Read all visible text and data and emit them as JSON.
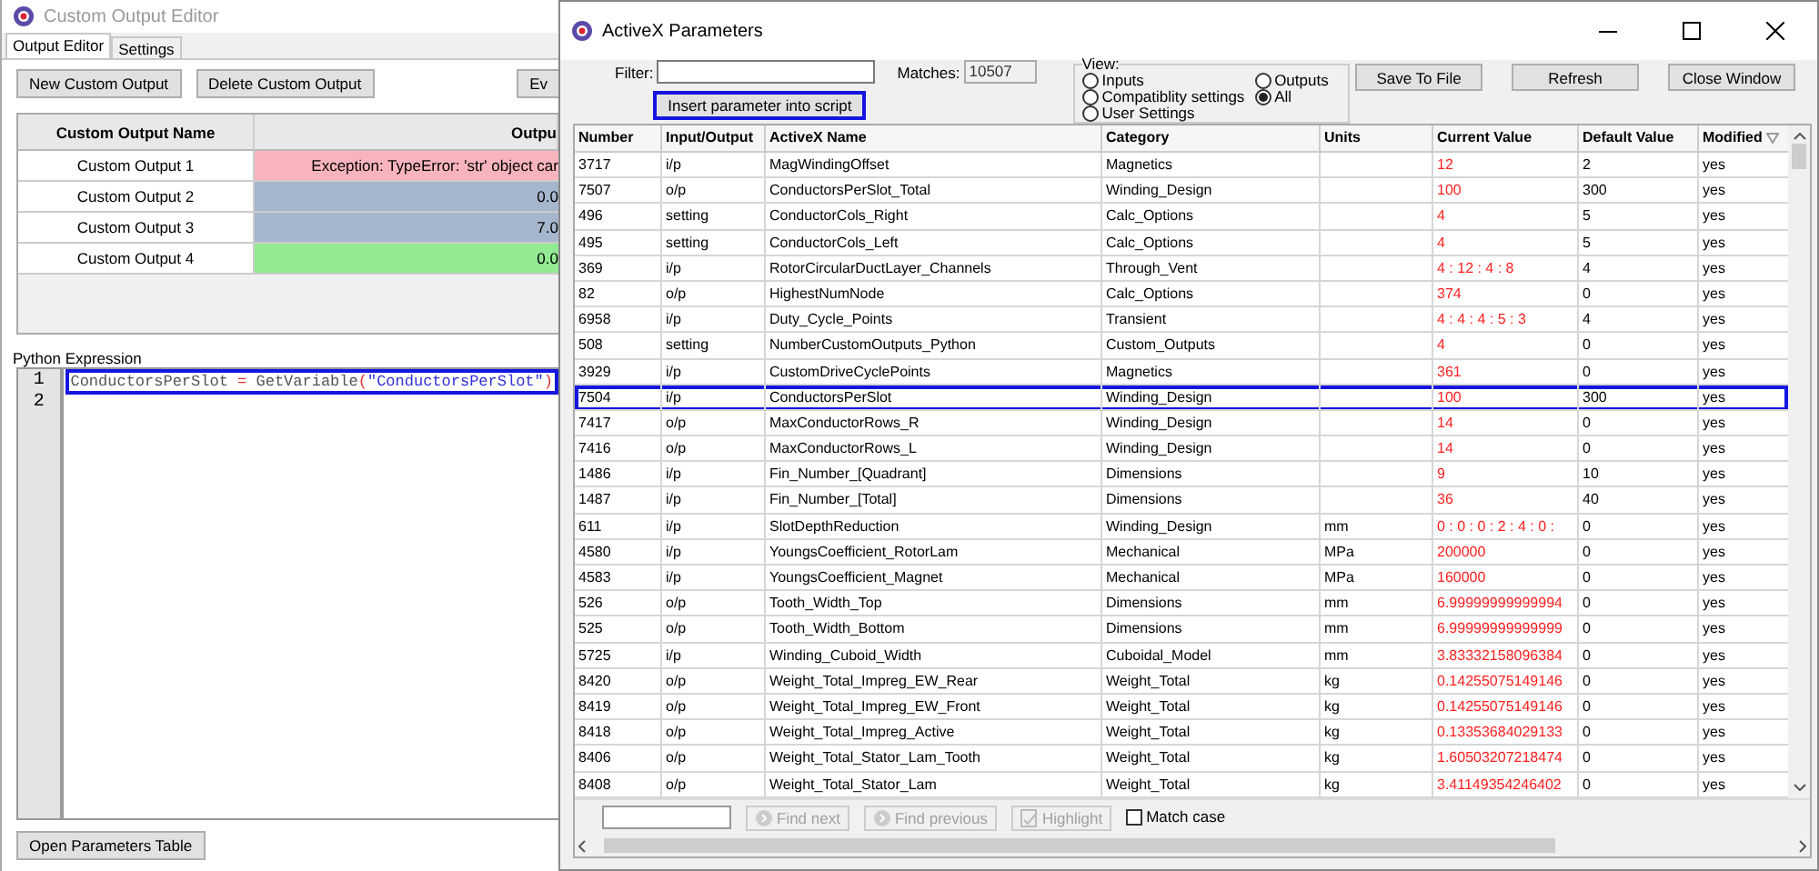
{
  "editor_window": {
    "title": "Custom Output Editor",
    "tabs": [
      {
        "label": "Output Editor",
        "selected": true
      },
      {
        "label": "Settings",
        "selected": false
      }
    ],
    "buttons": [
      "New Custom Output",
      "Delete Custom Output",
      "Ev"
    ],
    "grid": {
      "columns": [
        "Custom Output Name",
        "Outpu"
      ],
      "rows": [
        {
          "name": "Custom Output 1",
          "output": "Exception: TypeError: 'str' object car",
          "color": "#f8b4bc"
        },
        {
          "name": "Custom Output 2",
          "output": "0.0",
          "color": "#a6b6cc"
        },
        {
          "name": "Custom Output 3",
          "output": "7.0",
          "color": "#a6b6cc"
        },
        {
          "name": "Custom Output 4",
          "output": "0.0",
          "color": "#92ea92"
        }
      ]
    },
    "python_expression": {
      "label": "Python Expression",
      "lines": [
        {
          "number": "1",
          "highlighted": true,
          "tokens": [
            {
              "text": "ConductorsPerSlot ",
              "kind": "ident"
            },
            {
              "text": "= ",
              "kind": "op"
            },
            {
              "text": "GetVariable",
              "kind": "ident"
            },
            {
              "text": "(",
              "kind": "op"
            },
            {
              "text": "\"ConductorsPerSlot\"",
              "kind": "string"
            },
            {
              "text": ")",
              "kind": "op"
            }
          ]
        },
        {
          "number": "2",
          "highlighted": false
        }
      ]
    },
    "bottom_button": "Open Parameters Table"
  },
  "params_window": {
    "title": "ActiveX Parameters",
    "filter": {
      "label": "Filter:"
    },
    "insert_button": {
      "label": "Insert parameter into script",
      "highlighted": true
    },
    "matches": {
      "label": "Matches:",
      "value": "10507"
    },
    "view": {
      "label": "View:",
      "options": [
        {
          "label": "Inputs",
          "selected": false
        },
        {
          "label": "Outputs",
          "selected": false
        },
        {
          "label": "Compatiblity settings",
          "selected": false
        },
        {
          "label": "All",
          "selected": true
        },
        {
          "label": "User Settings",
          "selected": false
        }
      ]
    },
    "buttons": [
      "Save To File",
      "Refresh",
      "Close Window"
    ],
    "table": {
      "columns": [
        "Number",
        "Input/Output",
        "ActiveX Name",
        "Category",
        "Units",
        "Current Value",
        "Default Value",
        "Modified"
      ],
      "rows": [
        {
          "cells": [
            "3717",
            "i/p",
            "MagWindingOffset",
            "Magnetics",
            "",
            "12",
            "2",
            "yes"
          ],
          "highlighted": false
        },
        {
          "cells": [
            "7507",
            "o/p",
            "ConductorsPerSlot_Total",
            "Winding_Design",
            "",
            "100",
            "300",
            "yes"
          ],
          "highlighted": false
        },
        {
          "cells": [
            "496",
            "setting",
            "ConductorCols_Right",
            "Calc_Options",
            "",
            "4",
            "5",
            "yes"
          ],
          "highlighted": false
        },
        {
          "cells": [
            "495",
            "setting",
            "ConductorCols_Left",
            "Calc_Options",
            "",
            "4",
            "5",
            "yes"
          ],
          "highlighted": false
        },
        {
          "cells": [
            "369",
            "i/p",
            "RotorCircularDuctLayer_Channels",
            "Through_Vent",
            "",
            "4 : 12 : 4 : 8",
            "4",
            "yes"
          ],
          "highlighted": false
        },
        {
          "cells": [
            "82",
            "o/p",
            "HighestNumNode",
            "Calc_Options",
            "",
            "374",
            "0",
            "yes"
          ],
          "highlighted": false
        },
        {
          "cells": [
            "6958",
            "i/p",
            "Duty_Cycle_Points",
            "Transient",
            "",
            "4 : 4 : 4 : 5 : 3",
            "4",
            "yes"
          ],
          "highlighted": false
        },
        {
          "cells": [
            "508",
            "setting",
            "NumberCustomOutputs_Python",
            "Custom_Outputs",
            "",
            "4",
            "0",
            "yes"
          ],
          "highlighted": false
        },
        {
          "cells": [
            "3929",
            "i/p",
            "CustomDriveCyclePoints",
            "Magnetics",
            "",
            "361",
            "0",
            "yes"
          ],
          "highlighted": false
        },
        {
          "cells": [
            "7504",
            "i/p",
            "ConductorsPerSlot",
            "Winding_Design",
            "",
            "100",
            "300",
            "yes"
          ],
          "highlighted": true
        },
        {
          "cells": [
            "7417",
            "o/p",
            "MaxConductorRows_R",
            "Winding_Design",
            "",
            "14",
            "0",
            "yes"
          ],
          "highlighted": false
        },
        {
          "cells": [
            "7416",
            "o/p",
            "MaxConductorRows_L",
            "Winding_Design",
            "",
            "14",
            "0",
            "yes"
          ],
          "highlighted": false
        },
        {
          "cells": [
            "1486",
            "i/p",
            "Fin_Number_[Quadrant]",
            "Dimensions",
            "",
            "9",
            "10",
            "yes"
          ],
          "highlighted": false
        },
        {
          "cells": [
            "1487",
            "i/p",
            "Fin_Number_[Total]",
            "Dimensions",
            "",
            "36",
            "40",
            "yes"
          ],
          "highlighted": false
        },
        {
          "cells": [
            "611",
            "i/p",
            "SlotDepthReduction",
            "Winding_Design",
            "mm",
            "0 : 0 : 0 : 2 : 4 : 0 :",
            "0",
            "yes"
          ],
          "highlighted": false
        },
        {
          "cells": [
            "4580",
            "i/p",
            "YoungsCoefficient_RotorLam",
            "Mechanical",
            "MPa",
            "200000",
            "0",
            "yes"
          ],
          "highlighted": false
        },
        {
          "cells": [
            "4583",
            "i/p",
            "YoungsCoefficient_Magnet",
            "Mechanical",
            "MPa",
            "160000",
            "0",
            "yes"
          ],
          "highlighted": false
        },
        {
          "cells": [
            "526",
            "o/p",
            "Tooth_Width_Top",
            "Dimensions",
            "mm",
            "6.99999999999994",
            "0",
            "yes"
          ],
          "highlighted": false
        },
        {
          "cells": [
            "525",
            "o/p",
            "Tooth_Width_Bottom",
            "Dimensions",
            "mm",
            "6.99999999999999",
            "0",
            "yes"
          ],
          "highlighted": false
        },
        {
          "cells": [
            "5725",
            "i/p",
            "Winding_Cuboid_Width",
            "Cuboidal_Model",
            "mm",
            "3.83332158096384",
            "0",
            "yes"
          ],
          "highlighted": false
        },
        {
          "cells": [
            "8420",
            "o/p",
            "Weight_Total_Impreg_EW_Rear",
            "Weight_Total",
            "kg",
            "0.14255075149146",
            "0",
            "yes"
          ],
          "highlighted": false
        },
        {
          "cells": [
            "8419",
            "o/p",
            "Weight_Total_Impreg_EW_Front",
            "Weight_Total",
            "kg",
            "0.14255075149146",
            "0",
            "yes"
          ],
          "highlighted": false
        },
        {
          "cells": [
            "8418",
            "o/p",
            "Weight_Total_Impreg_Active",
            "Weight_Total",
            "kg",
            "0.13353684029133",
            "0",
            "yes"
          ],
          "highlighted": false
        },
        {
          "cells": [
            "8406",
            "o/p",
            "Weight_Total_Stator_Lam_Tooth",
            "Weight_Total",
            "kg",
            "1.60503207218474",
            "0",
            "yes"
          ],
          "highlighted": false
        },
        {
          "cells": [
            "8408",
            "o/p",
            "Weight_Total_Stator_Lam",
            "Weight_Total",
            "kg",
            "3.41149354246402",
            "0",
            "yes"
          ],
          "highlighted": false
        }
      ]
    },
    "find_bar": {
      "buttons": [
        {
          "label": "Find next",
          "disabled": true,
          "kind": "find"
        },
        {
          "label": "Find previous",
          "disabled": true,
          "kind": "find"
        },
        {
          "label": "Highlight",
          "disabled": true,
          "kind": "highlight"
        }
      ],
      "match_case": {
        "label": "Match case",
        "checked": false
      }
    }
  }
}
